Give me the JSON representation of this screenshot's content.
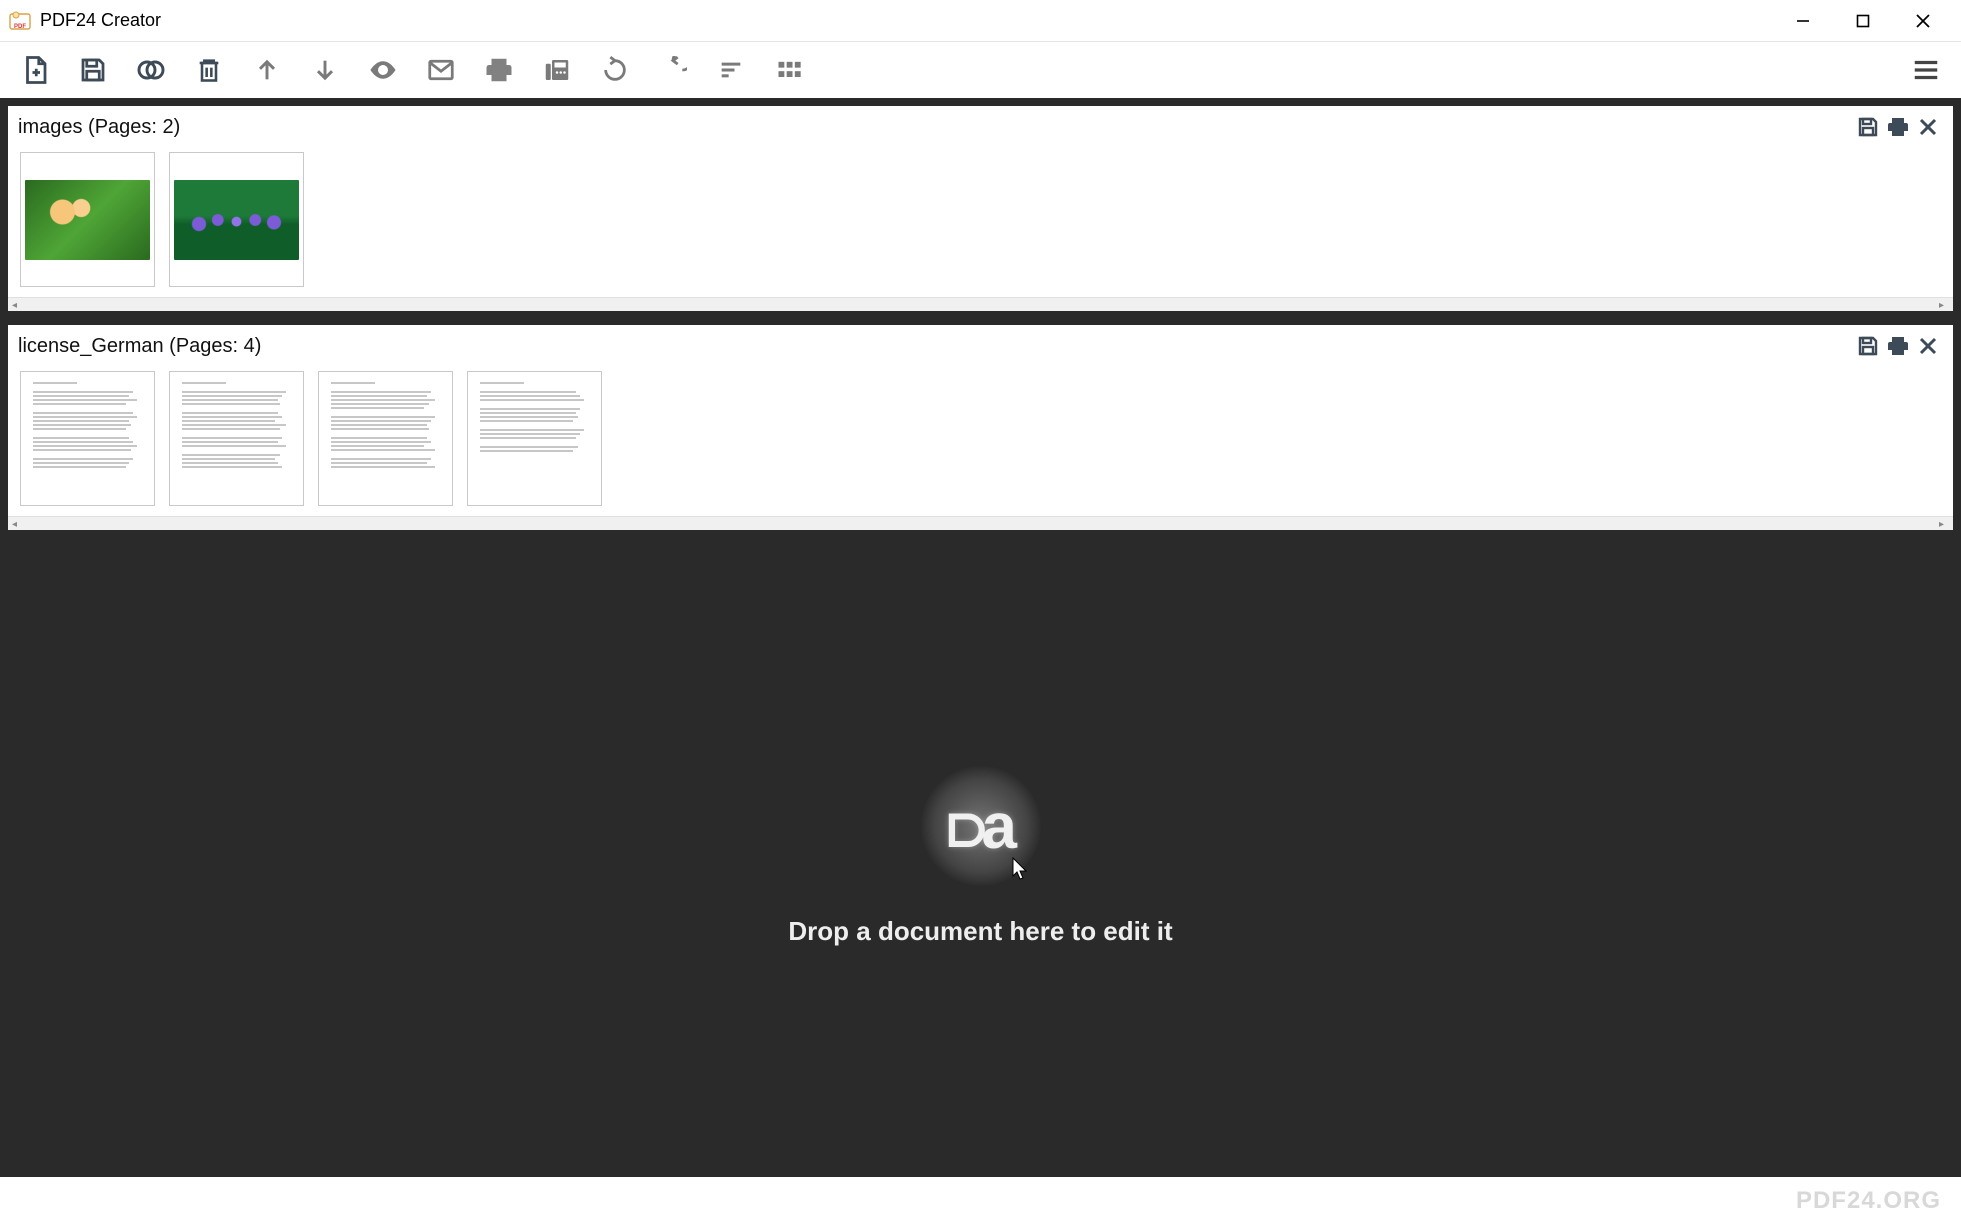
{
  "window": {
    "title": "PDF24 Creator"
  },
  "documents": [
    {
      "name": "images",
      "pages_label": "images (Pages: 2)",
      "page_count": 2,
      "type": "image"
    },
    {
      "name": "license_German",
      "pages_label": "license_German (Pages: 4)",
      "page_count": 4,
      "type": "text"
    }
  ],
  "dropzone": {
    "text": "Drop a document here to edit it"
  },
  "footer": {
    "brand": "PDF24.ORG"
  },
  "toolbar_icons": {
    "new": "new-file-icon",
    "save": "save-icon",
    "merge": "merge-icon",
    "delete": "trash-icon",
    "up": "arrow-up-icon",
    "down": "arrow-down-icon",
    "preview": "eye-icon",
    "email": "email-icon",
    "print": "print-icon",
    "fax": "fax-icon",
    "rotate_left": "rotate-left-icon",
    "rotate_right": "rotate-right-icon",
    "sort": "sort-icon",
    "grid": "grid-icon",
    "menu": "hamburger-icon"
  },
  "doc_actions": {
    "save": "save-icon",
    "print": "print-icon",
    "close": "close-icon"
  }
}
